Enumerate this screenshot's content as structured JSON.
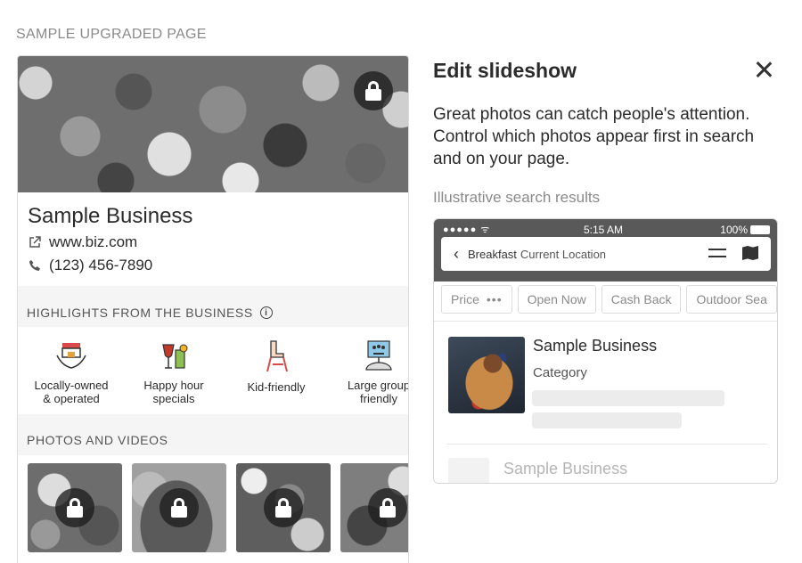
{
  "section_title": "SAMPLE UPGRADED PAGE",
  "business": {
    "name": "Sample Business",
    "website": "www.biz.com",
    "phone": "(123) 456-7890"
  },
  "highlights": {
    "title": "HIGHLIGHTS FROM THE BUSINESS",
    "items": [
      {
        "label_1": "Locally-owned",
        "label_2": "& operated",
        "icon": "store-hands-icon"
      },
      {
        "label_1": "Happy hour",
        "label_2": "specials",
        "icon": "cocktail-glass-icon"
      },
      {
        "label_1": "Kid-friendly",
        "label_2": "",
        "icon": "high-chair-icon"
      },
      {
        "label_1": "Large group",
        "label_2": "friendly",
        "icon": "group-table-icon"
      }
    ]
  },
  "photos": {
    "title": "PHOTOS AND VIDEOS"
  },
  "panel": {
    "title": "Edit slideshow",
    "description": "Great photos can catch people's attention. Control which photos appear first in search and on your page.",
    "illustrative_label": "Illustrative search results"
  },
  "phone": {
    "signal": "●●●●● ᯤ",
    "time": "5:15 AM",
    "battery": "100%",
    "search_query": "Breakfast",
    "search_location": "Current Location",
    "chips": [
      "Price",
      "Open Now",
      "Cash Back",
      "Outdoor Sea"
    ],
    "chip_price_more": "•••",
    "result": {
      "name": "Sample Business",
      "category": "Category"
    },
    "result2_name": "Sample Business"
  },
  "colors": {
    "status_bar": "#595959",
    "band_background": "#f5f5f5"
  }
}
